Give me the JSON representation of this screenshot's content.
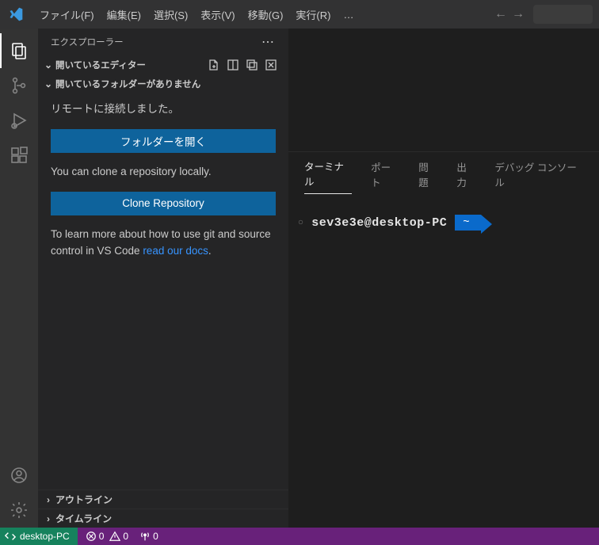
{
  "menubar": {
    "items": [
      "ファイル(F)",
      "編集(E)",
      "選択(S)",
      "表示(V)",
      "移動(G)",
      "実行(R)"
    ],
    "overflow": "…"
  },
  "sidebar": {
    "title": "エクスプローラー",
    "openEditorsLabel": "開いているエディター",
    "noFolderLabel": "開いているフォルダーがありません",
    "connectedMsg": "リモートに接続しました。",
    "openFolderBtn": "フォルダーを開く",
    "cloneMsg": "You can clone a repository locally.",
    "cloneBtn": "Clone Repository",
    "learnMsgPrefix": "To learn more about how to use git and source control in VS Code ",
    "learnLink": "read our docs",
    "learnMsgSuffix": ".",
    "outlineLabel": "アウトライン",
    "timelineLabel": "タイムライン"
  },
  "panel": {
    "tabs": [
      "ターミナル",
      "ポート",
      "問題",
      "出力",
      "デバッグ コンソール"
    ],
    "prompt_user": "sev3e3e@desktop-PC",
    "prompt_path": "~"
  },
  "statusbar": {
    "remoteHost": "desktop-PC",
    "errors": "0",
    "warnings": "0",
    "ports": "0"
  }
}
